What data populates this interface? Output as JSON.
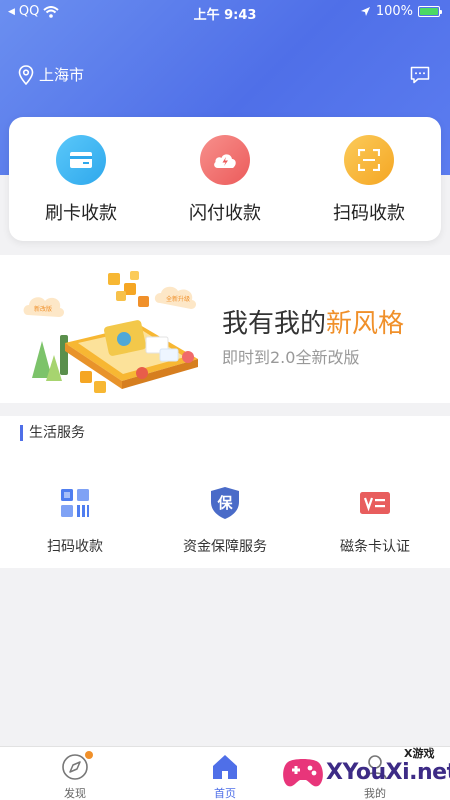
{
  "status_bar": {
    "carrier": "QQ",
    "time": "上午 9:43",
    "battery": "100%",
    "battery_level": 1.0
  },
  "header": {
    "city": "上海市",
    "location_icon": "location-pin-icon",
    "message_icon": "message-icon"
  },
  "quick_actions": [
    {
      "label": "刷卡收款",
      "icon": "card-icon",
      "color": "#3fb7f0"
    },
    {
      "label": "闪付收款",
      "icon": "cloud-flash-icon",
      "color": "#f06a6a"
    },
    {
      "label": "扫码收款",
      "icon": "scan-icon",
      "color": "#f7b733"
    }
  ],
  "banner": {
    "title_prefix": "我有我的",
    "title_highlight": "新风格",
    "subtitle": "即时到2.0全新改版",
    "art_labels": [
      "新改版",
      "全新升级"
    ]
  },
  "services": {
    "title": "生活服务",
    "items": [
      {
        "label": "扫码收款",
        "icon": "qr-grid-icon"
      },
      {
        "label": "资金保障服务",
        "icon": "shield-bao-icon",
        "glyph": "保"
      },
      {
        "label": "磁条卡认证",
        "icon": "card-verify-icon"
      }
    ]
  },
  "tabbar": {
    "items": [
      {
        "label": "发现",
        "icon": "compass-icon",
        "badge": true
      },
      {
        "label": "首页",
        "icon": "home-icon",
        "active": true
      },
      {
        "label": "我的",
        "icon": "profile-icon"
      }
    ]
  },
  "watermark": {
    "brand": "XYouXi.net",
    "small": "X游戏"
  },
  "colors": {
    "primary": "#4f6fe8",
    "accent_orange": "#f0902a"
  }
}
